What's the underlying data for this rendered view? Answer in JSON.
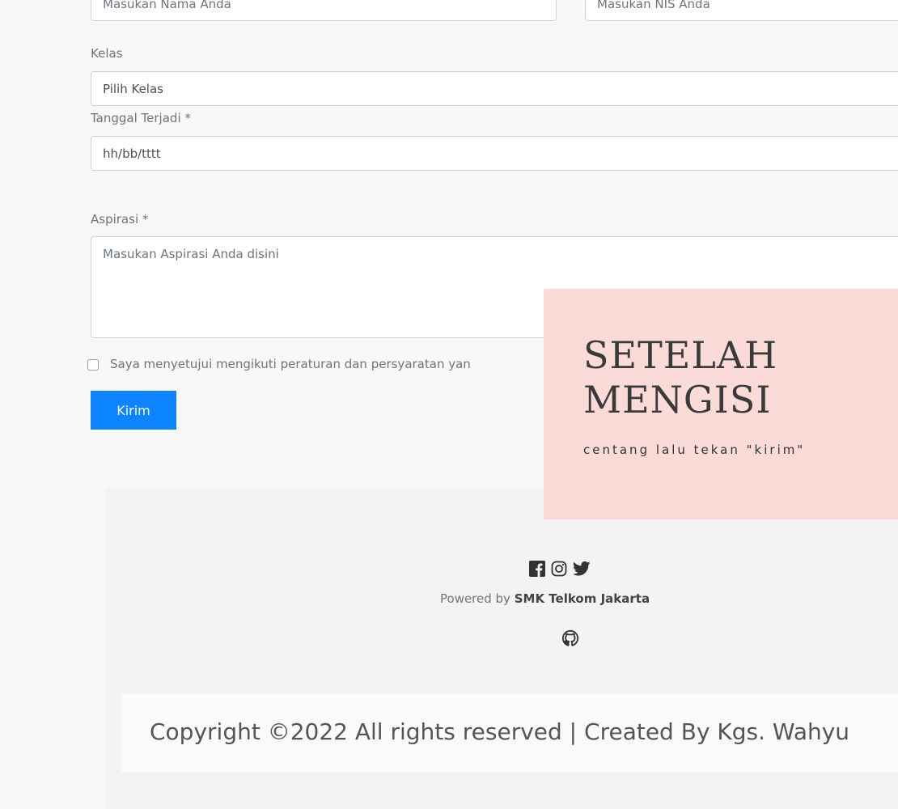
{
  "form": {
    "name_placeholder": "Masukan Nama Anda",
    "nis_placeholder": "Masukan NIS Anda",
    "kelas_label": "Kelas",
    "kelas_value": "Pilih Kelas",
    "tanggal_label": "Tanggal Terjadi *",
    "tanggal_value": "hh/bb/tttt",
    "aspirasi_label": "Aspirasi *",
    "aspirasi_placeholder": "Masukan Aspirasi Anda disini",
    "agree_label": "Saya menyetujui mengikuti peraturan dan persyaratan yan",
    "submit_label": "Kirim"
  },
  "note": {
    "title": "SETELAH MENGISI",
    "subtitle": "centang lalu tekan \"kirim\""
  },
  "footer": {
    "powered_prefix": "Powered by ",
    "powered_org": "SMK Telkom Jakarta",
    "copyright": "Copyright ©2022 All rights reserved | Created By Kgs. Wahyu",
    "icons": [
      "facebook-icon",
      "instagram-icon",
      "twitter-icon",
      "github-icon"
    ]
  },
  "colors": {
    "accent": "#0d84ff",
    "note_bg": "#fadbd8",
    "footer_bg": "#f3f3f3"
  }
}
